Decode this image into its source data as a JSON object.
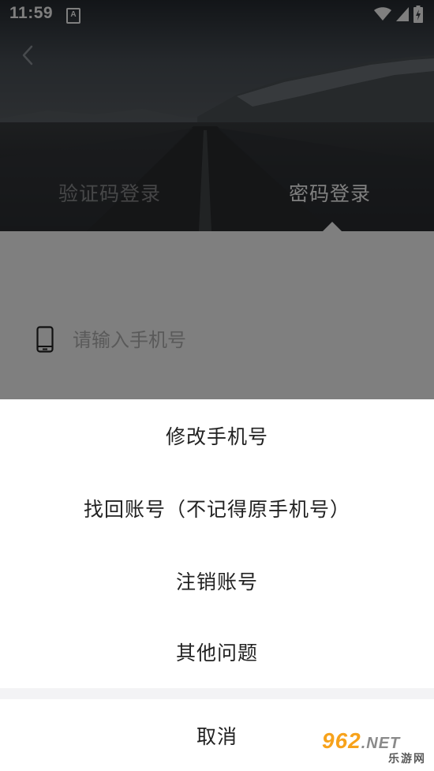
{
  "status_bar": {
    "time": "11:59",
    "notification_icon": "A"
  },
  "header": {
    "tabs": [
      {
        "label": "验证码登录",
        "active": false
      },
      {
        "label": "密码登录",
        "active": true
      }
    ]
  },
  "login_form": {
    "phone_placeholder": "请输入手机号"
  },
  "action_sheet": {
    "options": [
      "修改手机号",
      "找回账号（不记得原手机号）",
      "注销账号",
      "其他问题"
    ],
    "cancel_label": "取消"
  },
  "watermark": {
    "brand": "962",
    "domain": ".NET",
    "subtitle": "乐游网"
  },
  "colors": {
    "overlay": "#00000080",
    "sheet_background": "#ffffff",
    "sheet_gap": "#f3f3f5",
    "text_primary": "#222222",
    "watermark_orange": "#f7a21b"
  }
}
